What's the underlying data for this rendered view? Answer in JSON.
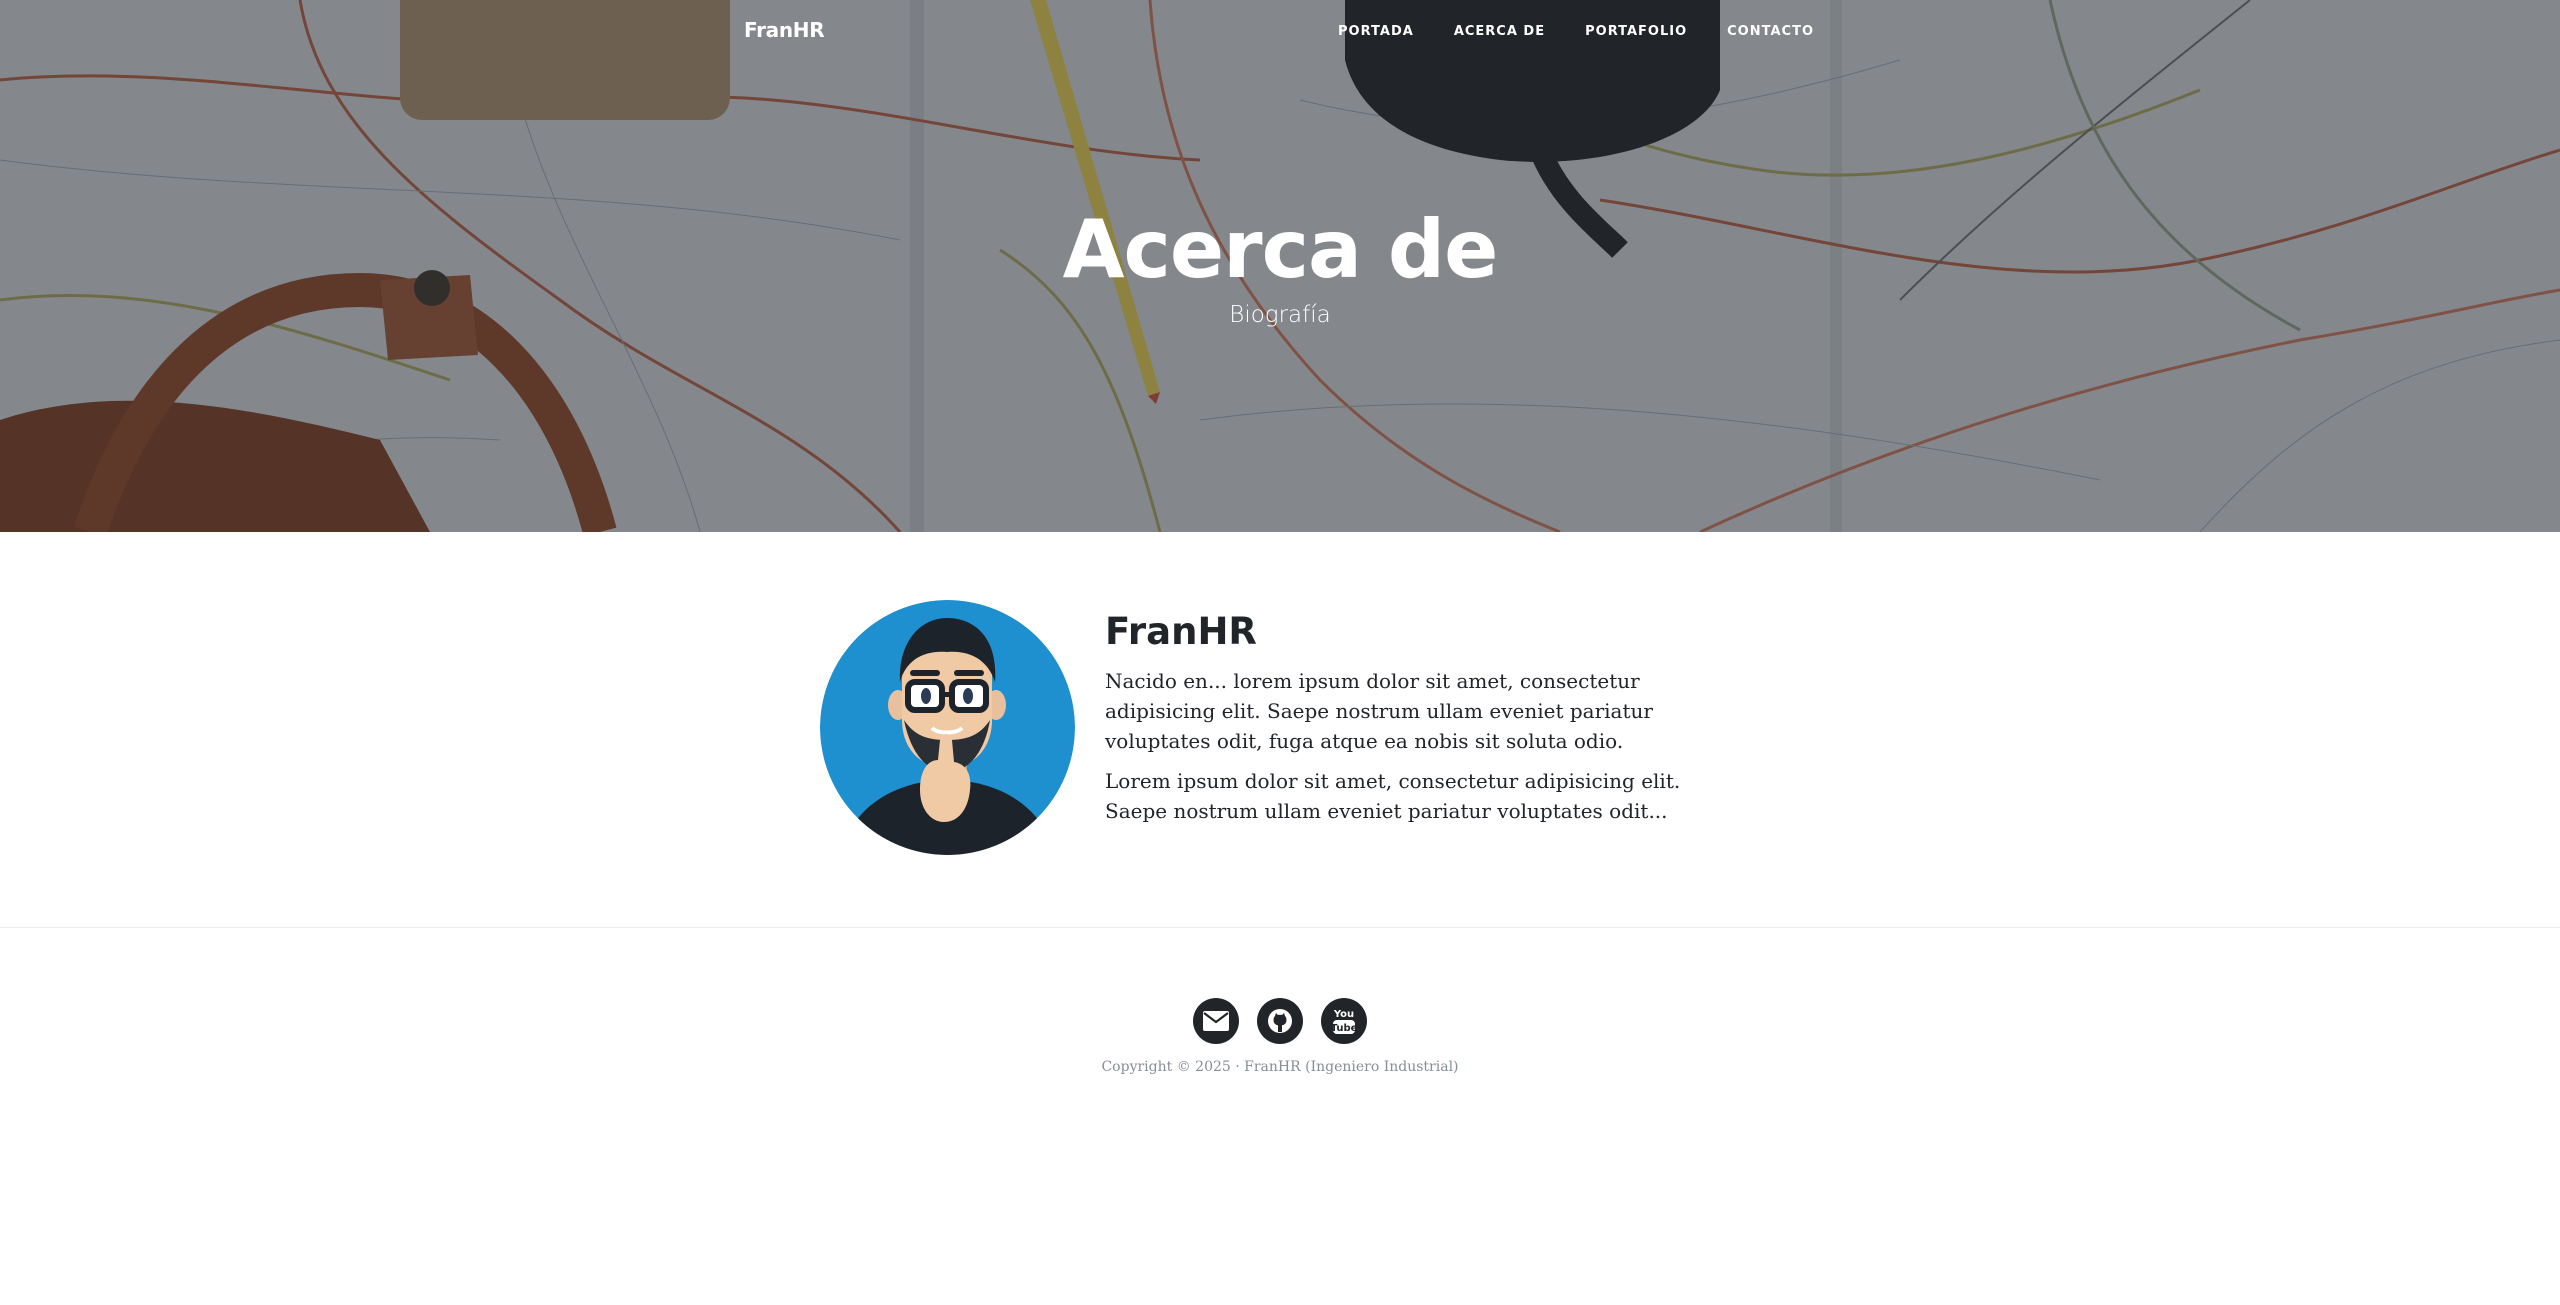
{
  "navbar": {
    "brand": "FranHR",
    "links": [
      "PORTADA",
      "ACERCA DE",
      "PORTAFOLIO",
      "CONTACTO"
    ]
  },
  "hero": {
    "title": "Acerca de",
    "subtitle": "Biografía",
    "background": "map-with-pencil-mug-and-bag"
  },
  "about": {
    "name": "FranHR",
    "paragraphs": [
      "Nacido en... lorem ipsum dolor sit amet, consectetur adipisicing elit. Saepe nostrum ullam eveniet pariatur voluptates odit, fuga atque ea nobis sit soluta odio.",
      "Lorem ipsum dolor sit amet, consectetur adipisicing elit. Saepe nostrum ullam eveniet pariatur voluptates odit..."
    ],
    "avatar_bg": "#1e8fcf"
  },
  "footer": {
    "social": [
      {
        "icon": "envelope-icon"
      },
      {
        "icon": "github-icon"
      },
      {
        "icon": "youtube-icon"
      }
    ],
    "copyright": "Copyright © 2025 · FranHR (Ingeniero Industrial)"
  },
  "colors": {
    "text": "#212529",
    "muted": "#868e96",
    "social_bg": "#212529"
  }
}
